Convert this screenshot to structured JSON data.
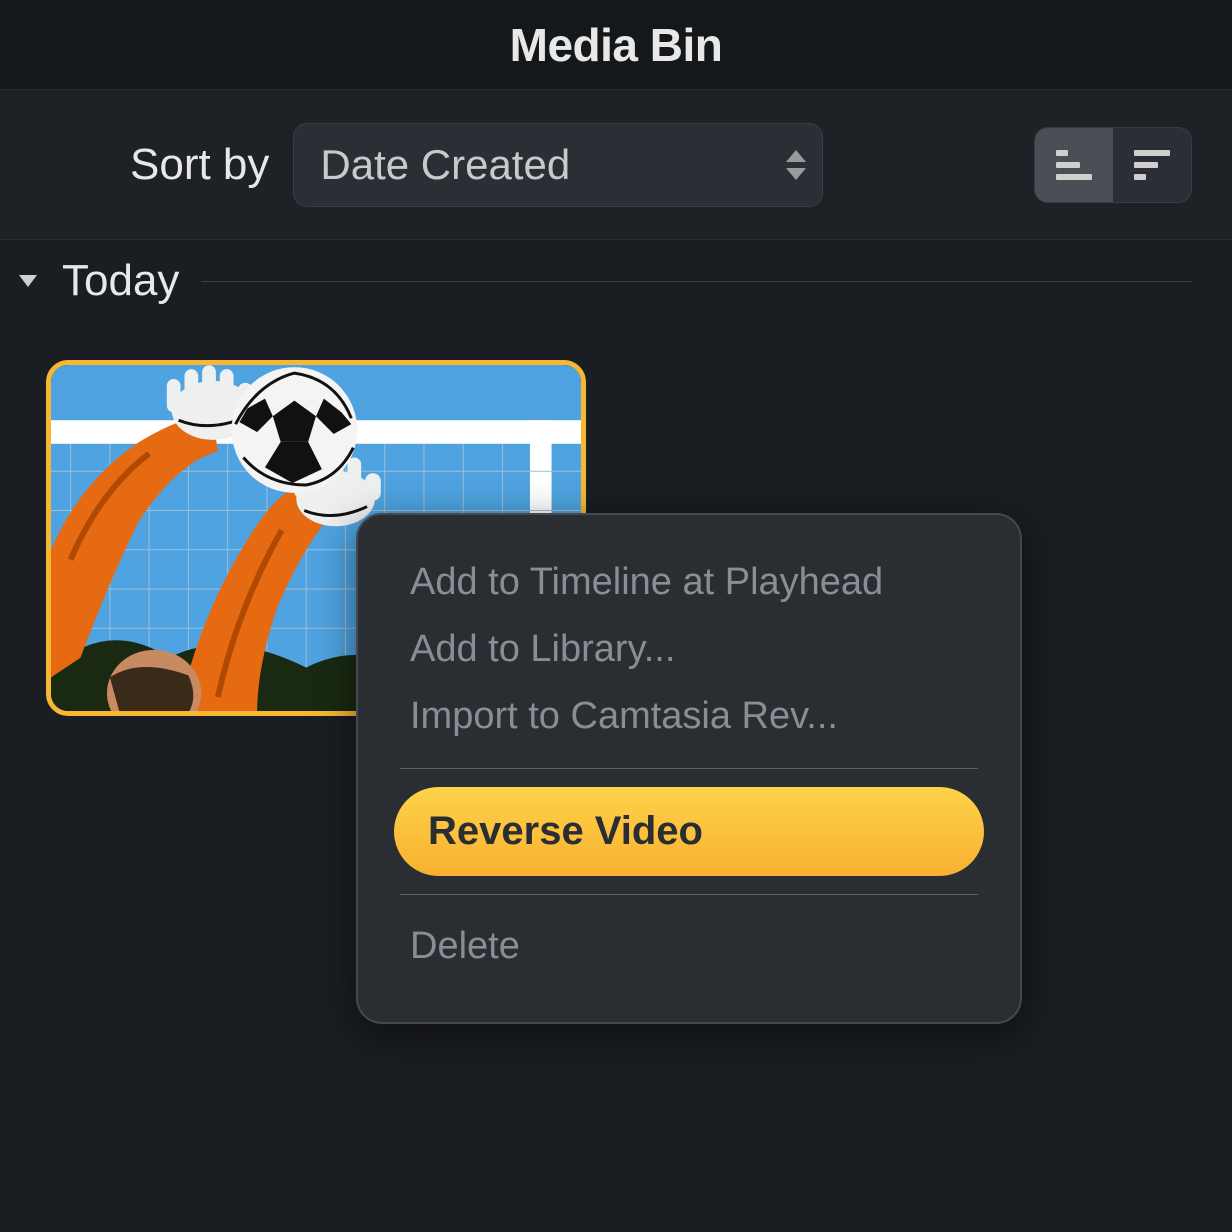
{
  "header": {
    "title": "Media Bin"
  },
  "sortbar": {
    "label": "Sort by",
    "selected": "Date Created",
    "order_active": "asc"
  },
  "section": {
    "title": "Today"
  },
  "thumbnail": {
    "description": "Goalkeeper catching soccer ball",
    "selected": true,
    "selection_color": "#f7b733"
  },
  "context_menu": {
    "items": [
      {
        "id": "add-timeline",
        "label": "Add to Timeline at Playhead",
        "type": "normal"
      },
      {
        "id": "add-library",
        "label": "Add to Library...",
        "type": "normal"
      },
      {
        "id": "import-rev",
        "label": "Import to Camtasia Rev...",
        "type": "normal"
      },
      {
        "id": "sep1",
        "type": "separator"
      },
      {
        "id": "reverse",
        "label": "Reverse Video",
        "type": "highlight"
      },
      {
        "id": "sep2",
        "type": "separator"
      },
      {
        "id": "delete",
        "label": "Delete",
        "type": "normal"
      }
    ]
  },
  "colors": {
    "bg": "#1a1d21",
    "panel": "#2a2d32",
    "accent": "#f7b733",
    "text": "#e8e8e8",
    "muted": "#8a8e94"
  }
}
